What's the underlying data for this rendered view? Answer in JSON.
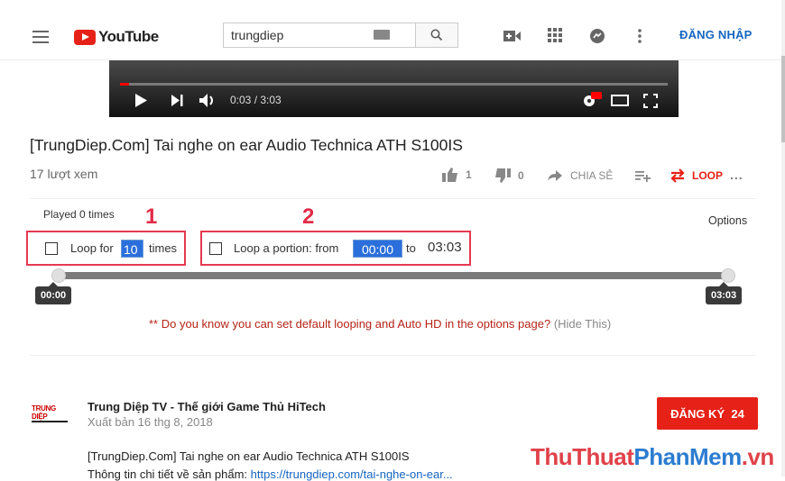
{
  "header": {
    "logo_text": "YouTube",
    "search_value": "trungdiep",
    "signin_label": "ĐĂNG NHẬP"
  },
  "player": {
    "time": "0:03 / 3:03",
    "progress_fraction": 0.016
  },
  "video": {
    "title": "[TrungDiep.Com] Tai nghe on ear Audio Technica ATH S100IS",
    "views": "17 lượt xem",
    "likes": "1",
    "dislikes": "0",
    "share_label": "CHIA SẺ",
    "loop_label": "LOOP",
    "more_label": "..."
  },
  "looper": {
    "played": "Played 0 times",
    "options": "Options",
    "marker1": "1",
    "marker2": "2",
    "loop_for_label": "Loop for",
    "loop_for_value": "10",
    "times_label": "times",
    "portion_label": "Loop a portion: from",
    "from_value": "00:00",
    "to_label": "to",
    "to_value": "03:03",
    "slider_start": "00:00",
    "slider_end": "03:03",
    "hint": "** Do you know you can set default looping and Auto HD in the options page?",
    "hide": "(Hide This)"
  },
  "channel": {
    "logo_text": "TRUNG DIỆP",
    "name": "Trung Diệp TV - Thế giới Game Thủ HiTech",
    "published": "Xuất bản 16 thg 8, 2018",
    "subscribe_label": "ĐĂNG KÝ",
    "subscribe_count": "24",
    "desc_line1": "[TrungDiep.Com] Tai nghe on ear Audio Technica ATH S100IS",
    "desc_line2_prefix": "Thông tin chi tiết về sản phẩm: ",
    "desc_line2_link": "https://trungdiep.com/tai-nghe-on-ear..."
  },
  "watermark": {
    "part1": "ThuThuat",
    "part2": "PhanMem",
    "part3": ".vn"
  },
  "colors": {
    "accent_red": "#e62117",
    "link_blue": "#1565c0",
    "marker_red": "#e22b47"
  }
}
